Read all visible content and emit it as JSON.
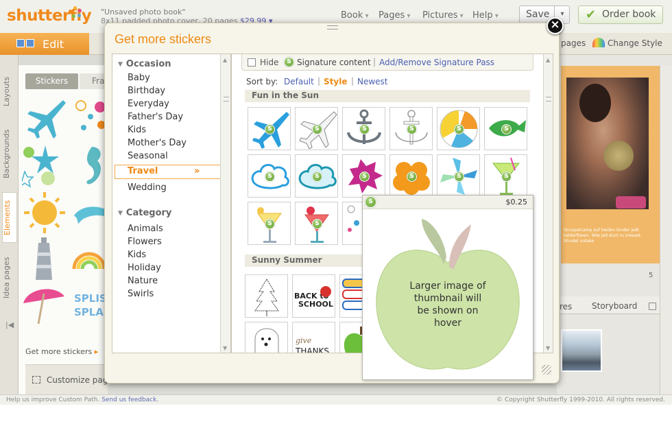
{
  "app": {
    "logo": "shutterfly",
    "book_title": "\"Unsaved photo book\"",
    "book_subtitle": "8x11 padded photo cover, 20 pages",
    "book_price": "$29.99",
    "menus": [
      "Book",
      "Pages",
      "Pictures",
      "Help"
    ],
    "save_label": "Save",
    "order_label": "Order book",
    "edit_tab": "Edit",
    "toolbar_pages": "pages",
    "toolbar_change_style": "Change Style",
    "rail_tabs": [
      "Layouts",
      "Backgrounds",
      "Elements",
      "Idea pages"
    ],
    "sticker_tabs": [
      "Stickers",
      "Fra"
    ],
    "get_more_stickers": "Get more stickers",
    "customize_page": "Customize page",
    "page_number": "5",
    "storyboard_tabs": [
      "res",
      "Storyboard"
    ],
    "photo_caption": "Ocnapalcamp auf heiden binder jedt kalderfiasen. Wiw jed dunt ru sreeset. Strudel nutake",
    "status_left": "Help us improve Custom Path.",
    "status_link": "Send us feedback.",
    "status_right": "© Copyright Shutterfly 1999-2010. All rights reserved."
  },
  "modal": {
    "title": "Get more stickers",
    "close_icon": "close-icon",
    "categories": {
      "occasion_heading": "Occasion",
      "occasion_items": [
        "Baby",
        "Birthday",
        "Everyday",
        "Father's Day",
        "Kids",
        "Mother's Day",
        "Seasonal",
        "Travel",
        "Wedding"
      ],
      "selected": "Travel",
      "selected_arrow": "»",
      "category_heading": "Category",
      "category_items": [
        "Animals",
        "Flowers",
        "Kids",
        "Holiday",
        "Nature",
        "Swirls"
      ]
    },
    "filter": {
      "hide_label": "Hide",
      "signature_label": "Signature content",
      "separator": "|",
      "signature_link": "Add/Remove Signature Pass"
    },
    "sort": {
      "label": "Sort by:",
      "options": [
        "Default",
        "Style",
        "Newest"
      ],
      "active": "Style"
    },
    "sections": [
      {
        "title": "Fun in the Sun"
      },
      {
        "title": "Sunny Summer"
      }
    ],
    "hover": {
      "price": "$0.25",
      "note": "Larger image of thumbnail will be shown on hover"
    }
  },
  "colors": {
    "accent_orange": "#ee8a16",
    "link_blue": "#4a5fb0",
    "signature_green": "#6aa735",
    "apple_green": "#cde3a8"
  }
}
